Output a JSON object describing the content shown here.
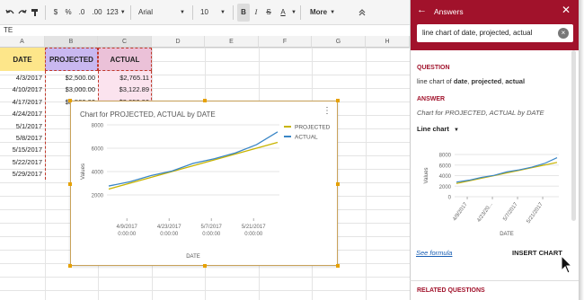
{
  "toolbar": {
    "zoom": "123",
    "dollar": "$",
    "percent": "%",
    "dec_less": ".0",
    "dec_more": ".00",
    "font": "Arial",
    "size": "10",
    "bold": "B",
    "italic": "I",
    "strike": "S",
    "text_color": "A",
    "more": "More"
  },
  "name_box": "TE",
  "columns": [
    "A",
    "B",
    "C",
    "D",
    "E",
    "F",
    "G",
    "H"
  ],
  "sheet": {
    "headers": [
      "DATE",
      "PROJECTED",
      "ACTUAL"
    ],
    "rows": [
      [
        "4/3/2017",
        "$2,500.00",
        "$2,765.11"
      ],
      [
        "4/10/2017",
        "$3,000.00",
        "$3,122.89"
      ],
      [
        "4/17/2017",
        "$3,500.00",
        "$3,658.00"
      ],
      [
        "4/24/2017",
        "$4",
        "$"
      ],
      [
        "5/1/2017",
        "$4",
        "$"
      ],
      [
        "5/8/2017",
        "$5",
        "$"
      ],
      [
        "5/15/2017",
        "$5",
        "$"
      ],
      [
        "5/22/2017",
        "$6",
        "$"
      ],
      [
        "5/29/2017",
        "$6",
        "$"
      ]
    ]
  },
  "chart": {
    "title": "Chart for PROJECTED, ACTUAL by DATE",
    "menu": "⋮",
    "ylabel": "Values",
    "xlabel": "DATE",
    "legend": [
      "PROJECTED",
      "ACTUAL"
    ],
    "x_ticks": [
      "4/9/2017",
      "4/23/2017",
      "5/7/2017",
      "5/21/2017"
    ],
    "x_time": "0:00:00",
    "y_ticks": [
      "2000",
      "4000",
      "6000",
      "8000"
    ]
  },
  "side": {
    "title": "Answers",
    "query": "line chart of date, projected, actual",
    "question_label": "QUESTION",
    "question_prefix": "line chart of ",
    "question_date": "date",
    "question_sep1": ", ",
    "question_projected": "projected",
    "question_sep2": ", ",
    "question_actual": "actual",
    "answer_label": "ANSWER",
    "answer_text": "Chart for PROJECTED, ACTUAL by DATE",
    "chart_type": "Line chart",
    "mini_y_ticks": [
      "0",
      "2000",
      "4000",
      "6000",
      "8000"
    ],
    "mini_x_ticks": [
      "4/9/2017",
      "4/23/20...",
      "5/7/2017",
      "5/21/2017"
    ],
    "mini_ylabel": "Values",
    "mini_xlabel": "DATE",
    "see_formula": "See formula",
    "insert_chart": "INSERT CHART",
    "related": "RELATED QUESTIONS"
  },
  "colors": {
    "projected": "#c8b400",
    "actual": "#3a86c6",
    "accent": "#a1122b"
  },
  "chart_data": {
    "type": "line",
    "title": "Chart for PROJECTED, ACTUAL by DATE",
    "xlabel": "DATE",
    "ylabel": "Values",
    "x": [
      "4/3/2017",
      "4/10/2017",
      "4/17/2017",
      "4/24/2017",
      "5/1/2017",
      "5/8/2017",
      "5/15/2017",
      "5/22/2017",
      "5/29/2017"
    ],
    "ylim": [
      0,
      8000
    ],
    "series": [
      {
        "name": "PROJECTED",
        "values": [
          2500,
          3000,
          3500,
          4000,
          4500,
          5000,
          5500,
          6000,
          6500
        ]
      },
      {
        "name": "ACTUAL",
        "values": [
          2765,
          3123,
          3658,
          4050,
          4700,
          5100,
          5600,
          6300,
          7400
        ]
      }
    ]
  }
}
